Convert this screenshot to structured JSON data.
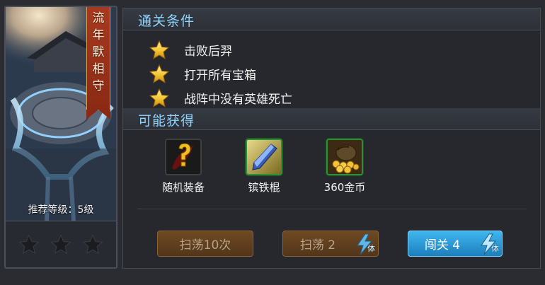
{
  "stage": {
    "title": "流年默相守",
    "recommended_level": "推荐等级：5级",
    "stars_earned": 0,
    "stars_total": 3
  },
  "conditions": {
    "header": "通关条件",
    "items": [
      {
        "text": "击败后羿",
        "icon": "gold-star-icon"
      },
      {
        "text": "打开所有宝箱",
        "icon": "gold-star-icon"
      },
      {
        "text": "战阵中没有英雄死亡",
        "icon": "gold-star-icon"
      }
    ]
  },
  "rewards": {
    "header": "可能获得",
    "items": [
      {
        "name": "随机装备",
        "icon": "random-equipment-icon"
      },
      {
        "name": "镔铁棍",
        "icon": "iron-bar-icon"
      },
      {
        "name": "360金币",
        "icon": "gold-coin-bag-icon"
      }
    ]
  },
  "actions": {
    "sweep10_label": "扫荡10次",
    "sweep_label": "扫荡 2",
    "challenge_label": "闯关 4",
    "stamina_label": "体"
  },
  "colors": {
    "header_text": "#8fd4ff",
    "sweep_button": "#6e4a24",
    "challenge_button": "#2a9ad6",
    "banner": "#a8391f",
    "star_gold": "#f4c430"
  }
}
